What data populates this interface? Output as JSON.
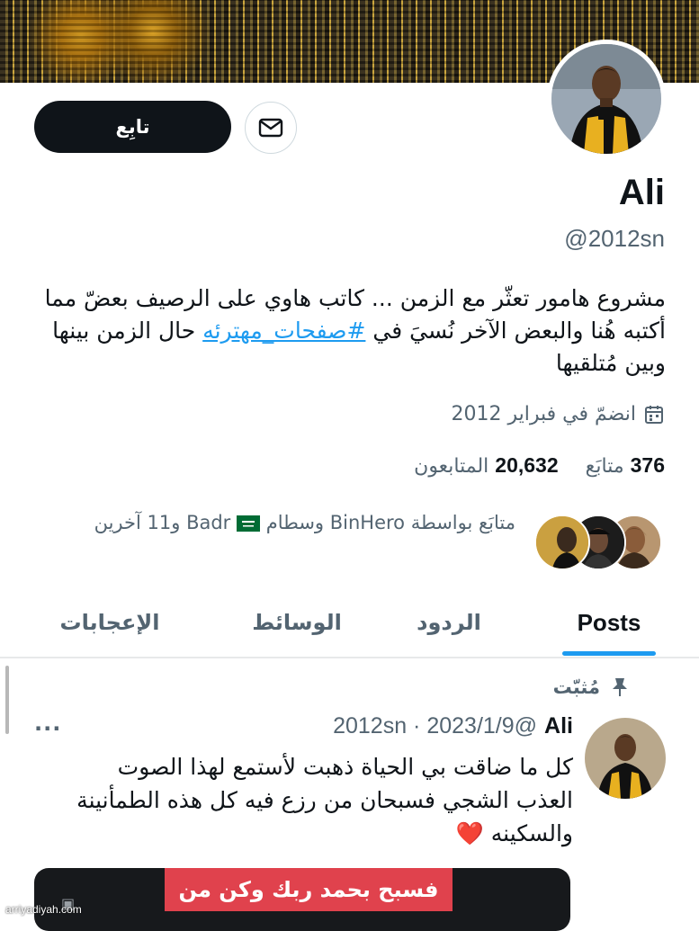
{
  "profile": {
    "follow_label": "تابِع",
    "name": "Ali",
    "handle": "@2012sn",
    "bio_prefix": "مشروع هامور تعثّر مع الزمن ... كاتب هاوي على الرصيف بعضّ مما أكتبه هُنا والبعض الآخر نُسيَ في ",
    "bio_hashtag": "#صفحات_مهترئه",
    "bio_suffix": " حال الزمن بينها وبين مُتلقيها",
    "joined": "انضمّ في فبراير 2012"
  },
  "stats": {
    "following_count": "376",
    "following_label": "متابَع",
    "followers_count": "20,632",
    "followers_label": "المتابعون"
  },
  "followed_by": {
    "text_before_flag": "متابَع بواسطة BinHero وسطام",
    "text_after_flag": "Badr و11 آخرين"
  },
  "tabs": [
    {
      "label": "Posts"
    },
    {
      "label": "الردود"
    },
    {
      "label": "الوسائط"
    },
    {
      "label": "الإعجابات"
    }
  ],
  "pinned_post": {
    "pinned_label": "مُثبّت",
    "author_name": "Ali",
    "author_meta": "@2012sn · 2023/1/9",
    "more_label": "···",
    "text": "كل ما ضاقت بي الحياة ذهبت لأستمع لهذا الصوت العذب الشجي فسبحان من رزع فيه كل هذه الطمأنينة والسكينه ❤️",
    "media_caption": "فسبح بحمد ربك وكن من"
  },
  "watermark": "arriyadiyah.com",
  "colors": {
    "accent": "#1d9bf0",
    "text_primary": "#0f1419",
    "text_secondary": "#536471",
    "button_dark": "#0f1419"
  }
}
